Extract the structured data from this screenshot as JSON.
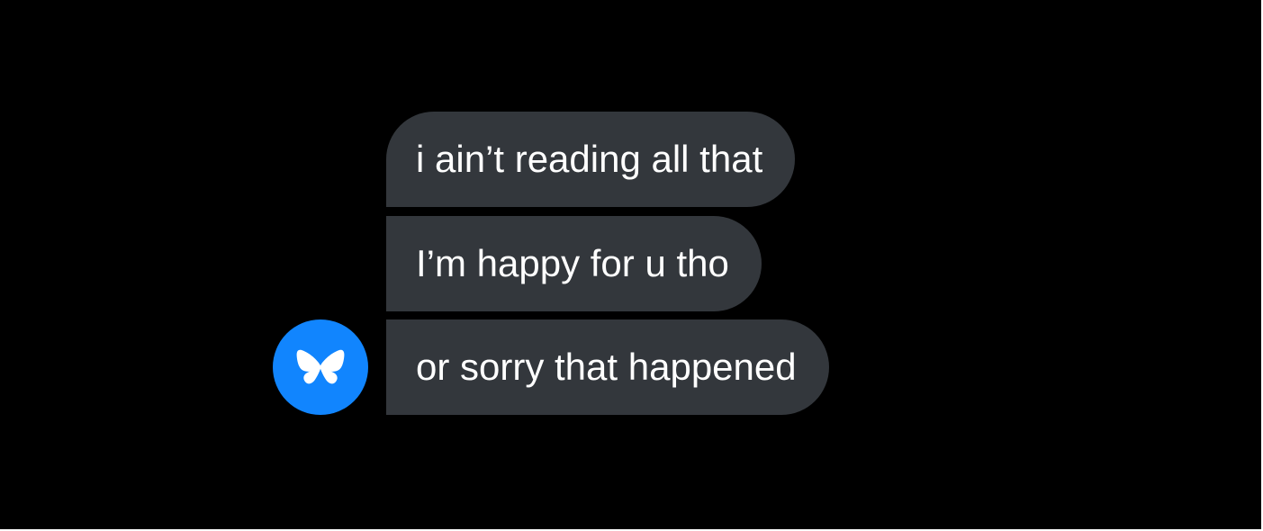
{
  "colors": {
    "background": "#000000",
    "bubble": "#33373c",
    "bubble_text": "#ffffff",
    "avatar_bg": "#1185fe",
    "avatar_icon": "#ffffff"
  },
  "conversation": {
    "sender_avatar_icon": "butterfly-icon",
    "messages": [
      {
        "text": "i ain’t reading all that"
      },
      {
        "text": "I’m happy for u tho"
      },
      {
        "text": "or sorry that happened"
      }
    ]
  }
}
